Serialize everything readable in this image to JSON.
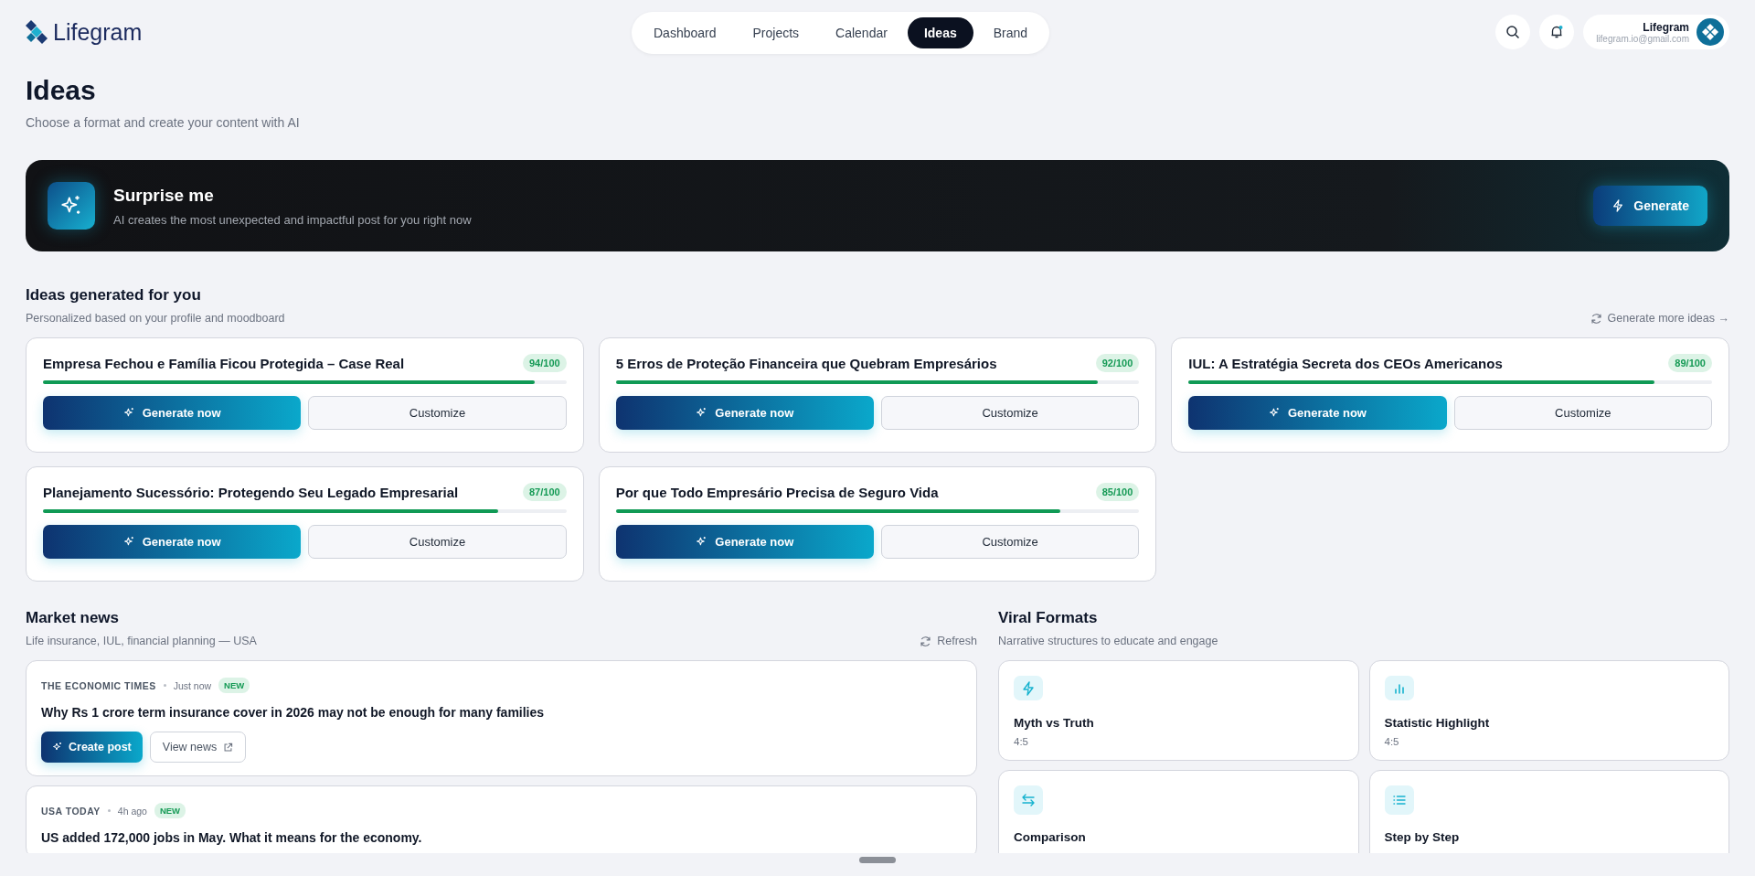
{
  "brand": {
    "name": "Lifegram"
  },
  "nav": [
    {
      "label": "Dashboard",
      "selected": false
    },
    {
      "label": "Projects",
      "selected": false
    },
    {
      "label": "Calendar",
      "selected": false
    },
    {
      "label": "Ideas",
      "selected": true
    },
    {
      "label": "Brand",
      "selected": false
    }
  ],
  "account": {
    "name": "Lifegram",
    "email": "lifegram.io@gmail.com"
  },
  "page": {
    "title": "Ideas",
    "subtitle": "Choose a format and create your content with AI"
  },
  "hero": {
    "title": "Surprise me",
    "text": "AI creates the most unexpected and impactful post for you right now",
    "button": "Generate"
  },
  "ideas": {
    "title": "Ideas generated for you",
    "subtitle": "Personalized based on your profile and moodboard",
    "more_link": "Generate more ideas →",
    "cards": [
      {
        "title": "Empresa Fechou e Família Ficou Protegida – Case Real",
        "score": "94/100",
        "level": 0.94,
        "primary": "Generate now",
        "secondary": "Customize"
      },
      {
        "title": "5 Erros de Proteção Financeira que Quebram Empresários",
        "score": "92/100",
        "level": 0.92,
        "primary": "Generate now",
        "secondary": "Customize"
      },
      {
        "title": "IUL: A Estratégia Secreta dos CEOs Americanos",
        "score": "89/100",
        "level": 0.89,
        "primary": "Generate now",
        "secondary": "Customize"
      },
      {
        "title": "Planejamento Sucessório: Protegendo Seu Legado Empresarial",
        "score": "87/100",
        "level": 0.87,
        "primary": "Generate now",
        "secondary": "Customize"
      },
      {
        "title": "Por que Todo Empresário Precisa de Seguro Vida",
        "score": "85/100",
        "level": 0.85,
        "primary": "Generate now",
        "secondary": "Customize"
      }
    ]
  },
  "news": {
    "title": "Market news",
    "subtitle": "Life insurance, IUL, financial planning — USA",
    "refresh": "Refresh",
    "items": [
      {
        "source": "THE ECONOMIC TIMES",
        "time": "Just now",
        "badge": "NEW",
        "headline": "Why Rs 1 crore term insurance cover in 2026 may not be enough for many families",
        "actions": [
          "Create post",
          "View news"
        ]
      },
      {
        "source": "USA TODAY",
        "time": "4h ago",
        "badge": "NEW",
        "headline": "US added 172,000 jobs in May. What it means for the economy."
      }
    ]
  },
  "formats": {
    "title": "Viral Formats",
    "subtitle": "Narrative structures to educate and engage",
    "items": [
      {
        "kind": "bolt",
        "name": "Myth vs Truth",
        "ratio": "4:5"
      },
      {
        "kind": "chart",
        "name": "Statistic Highlight",
        "ratio": "4:5"
      },
      {
        "kind": "swap",
        "name": "Comparison"
      },
      {
        "kind": "list",
        "name": "Step by Step"
      }
    ]
  }
}
